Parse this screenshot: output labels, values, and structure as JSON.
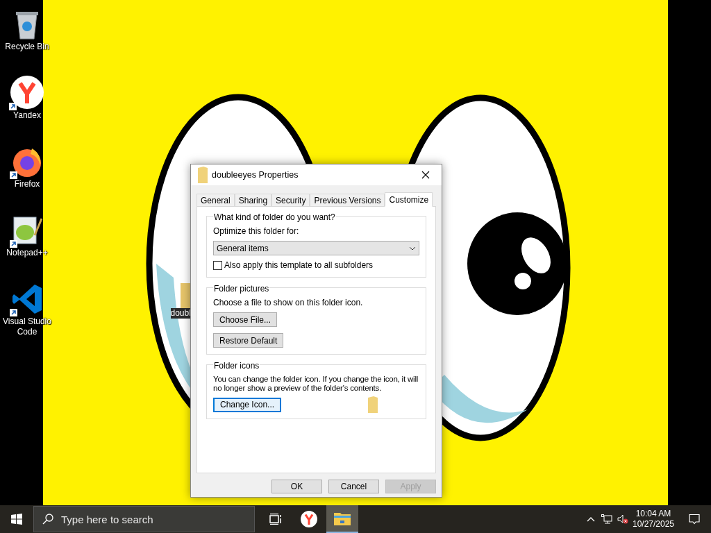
{
  "desktop_icons": [
    {
      "label": "Recycle Bin",
      "kind": "recycle-bin",
      "shortcut": false
    },
    {
      "label": "Yandex",
      "kind": "yandex",
      "shortcut": true
    },
    {
      "label": "Firefox",
      "kind": "firefox",
      "shortcut": true
    },
    {
      "label": "Notepad++",
      "kind": "notepad",
      "shortcut": true
    },
    {
      "label": "Visual Studio Code",
      "kind": "vscode",
      "shortcut": true
    }
  ],
  "folder_icon": {
    "label": "doubl"
  },
  "dialog": {
    "title": "doubleeyes Properties",
    "tabs": [
      {
        "label": "General",
        "selected": false
      },
      {
        "label": "Sharing",
        "selected": false
      },
      {
        "label": "Security",
        "selected": false
      },
      {
        "label": "Previous Versions",
        "selected": false
      },
      {
        "label": "Customize",
        "selected": true
      }
    ],
    "kind_group": {
      "title": "What kind of folder do you want?",
      "optimize_label": "Optimize this folder for:",
      "dropdown_value": "General items",
      "checkbox": {
        "label": "Also apply this template to all subfolders",
        "checked": false
      }
    },
    "pictures_group": {
      "title": "Folder pictures",
      "description": "Choose a file to show on this folder icon.",
      "buttons": [
        {
          "label": "Choose File...",
          "focused": false
        },
        {
          "label": "Restore Default",
          "focused": false
        }
      ]
    },
    "icons_group": {
      "title": "Folder icons",
      "description": "You can change the folder icon. If you change the icon, it will no longer show a preview of the folder's contents.",
      "button": {
        "label": "Change Icon...",
        "focused": true
      }
    },
    "buttons": [
      {
        "label": "OK",
        "disabled": false
      },
      {
        "label": "Cancel",
        "disabled": false
      },
      {
        "label": "Apply",
        "disabled": true
      }
    ]
  },
  "taskbar": {
    "search_placeholder": "Type here to search",
    "apps": [
      {
        "kind": "task-view",
        "active": false
      },
      {
        "kind": "yandex",
        "active": false
      },
      {
        "kind": "explorer",
        "active": true
      }
    ],
    "time": "10:04 AM",
    "date": "10/27/2025"
  }
}
